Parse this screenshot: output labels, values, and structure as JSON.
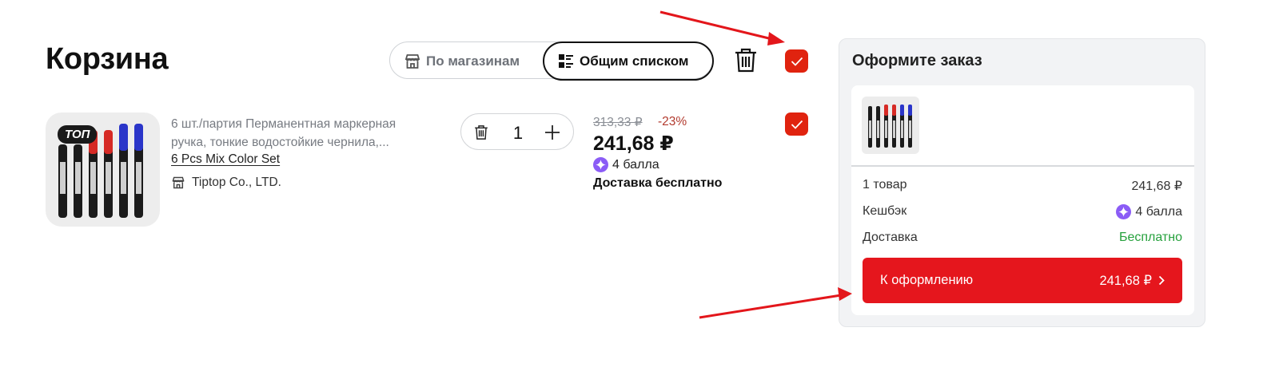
{
  "page": {
    "title": "Корзина"
  },
  "view_toggle": {
    "stores_label": "По магазинам",
    "list_label": "Общим списком",
    "active": "list"
  },
  "icons": {
    "store": "store-icon",
    "list": "list-icon",
    "trash": "trash-icon",
    "check": "check-icon",
    "plus": "plus-icon",
    "points": "sparkle-coin-icon",
    "chevron": "chevron-right-icon"
  },
  "select_all": {
    "checked": true
  },
  "cart_item": {
    "badge": "ТОП",
    "title_line1": "6 шт./партия Перманентная маркерная",
    "title_line2": "ручка, тонкие водостойкие чернила,...",
    "variant": "6 Pcs Mix Color Set",
    "seller": "Tiptop Co., LTD.",
    "quantity": "1",
    "old_price": "313,33 ₽",
    "discount": "-23%",
    "price": "241,68 ₽",
    "points": "4 балла",
    "delivery": "Доставка бесплатно",
    "checked": true
  },
  "summary": {
    "title": "Оформите заказ",
    "items_label": "1 товар",
    "items_value": "241,68 ₽",
    "cashback_label": "Кешбэк",
    "cashback_value": "4 балла",
    "delivery_label": "Доставка",
    "delivery_value": "Бесплатно",
    "checkout_label": "К оформлению",
    "checkout_total": "241,68 ₽"
  },
  "colors": {
    "accent_red": "#e5161d",
    "checkbox_red": "#e0230f",
    "free_green": "#26a13d",
    "points_purple": "#8b5cf6",
    "annotation_arrow": "#e3161b"
  }
}
